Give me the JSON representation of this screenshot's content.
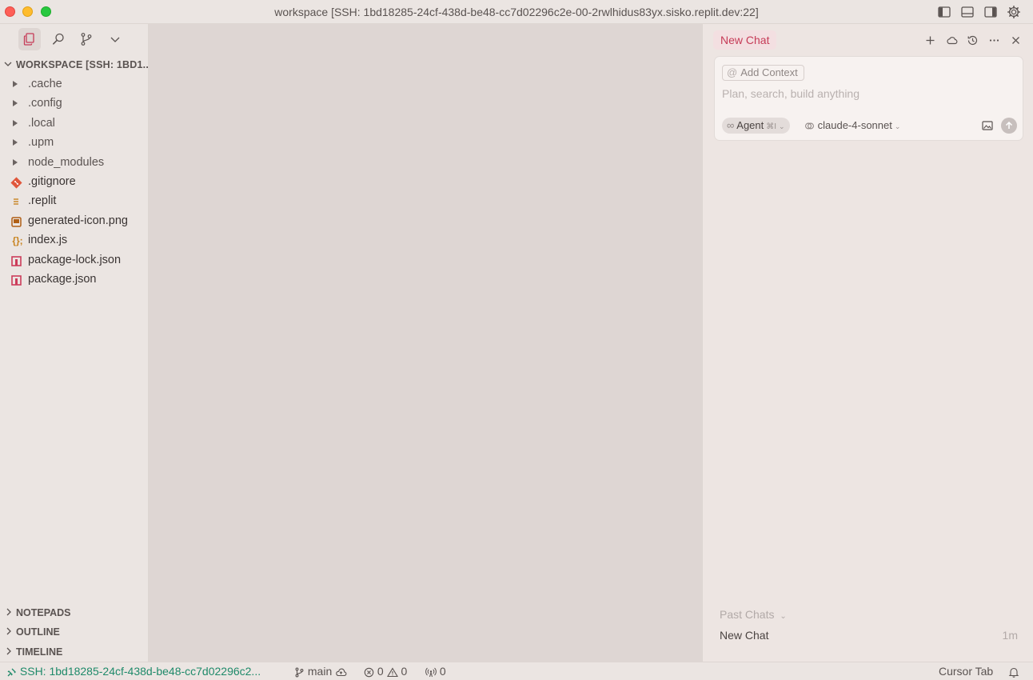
{
  "window": {
    "title": "workspace [SSH: 1bd18285-24cf-438d-be48-cc7d02296c2e-00-2rwlhidus83yx.sisko.replit.dev:22]"
  },
  "sidebar": {
    "workspace_label": "WORKSPACE [SSH: 1BD1...",
    "items": [
      {
        "name": ".cache",
        "type": "folder"
      },
      {
        "name": ".config",
        "type": "folder"
      },
      {
        "name": ".local",
        "type": "folder"
      },
      {
        "name": ".upm",
        "type": "folder"
      },
      {
        "name": "node_modules",
        "type": "folder"
      },
      {
        "name": ".gitignore",
        "type": "git-file"
      },
      {
        "name": ".replit",
        "type": "config-file"
      },
      {
        "name": "generated-icon.png",
        "type": "image-file"
      },
      {
        "name": "index.js",
        "type": "js-file"
      },
      {
        "name": "package-lock.json",
        "type": "json-file"
      },
      {
        "name": "package.json",
        "type": "json-file"
      }
    ],
    "sections": [
      "NOTEPADS",
      "OUTLINE",
      "TIMELINE"
    ]
  },
  "chat": {
    "tab_label": "New Chat",
    "add_context_label": "Add Context",
    "input_placeholder": "Plan, search, build anything",
    "mode_label": "Agent",
    "mode_shortcut": "⌘I",
    "model_label": "claude-4-sonnet",
    "past_chats_label": "Past Chats",
    "past_chats": [
      {
        "title": "New Chat",
        "time": "1m"
      }
    ]
  },
  "statusbar": {
    "remote_label": "SSH: 1bd18285-24cf-438d-be48-cc7d02296c2...",
    "branch": "main",
    "errors": "0",
    "warnings": "0",
    "ports": "0",
    "cursor_tab": "Cursor Tab"
  },
  "colors": {
    "accent": "#c63b57",
    "remote": "#1f8a6a",
    "background": "#ebe5e2",
    "editor": "#ded6d3"
  }
}
